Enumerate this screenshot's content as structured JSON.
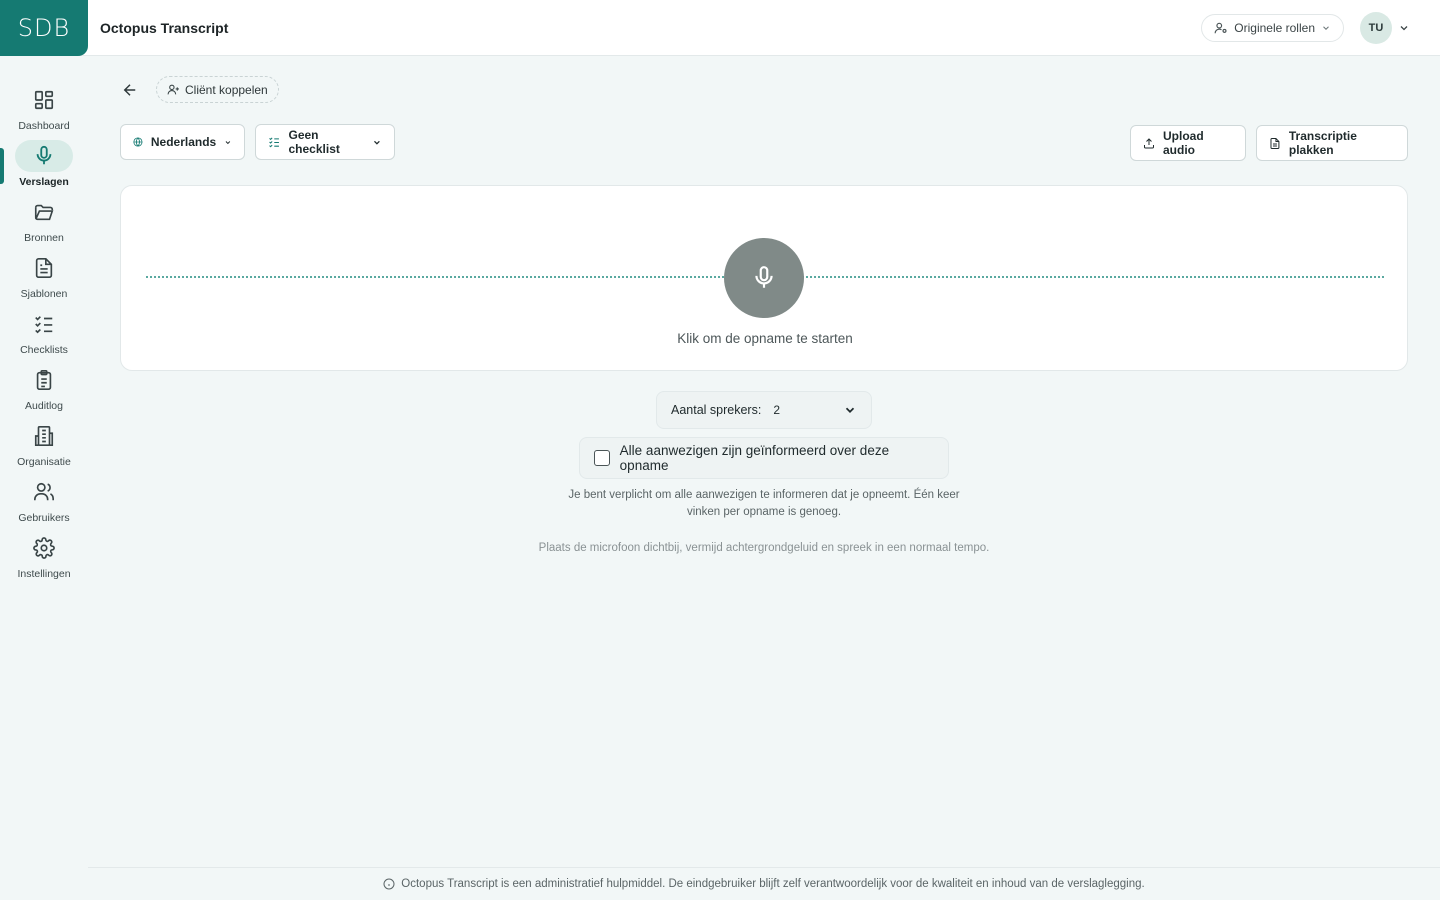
{
  "header": {
    "logo": "SDB",
    "app_title": "Octopus Transcript",
    "role_switch": "Originele rollen",
    "user_initials": "TU"
  },
  "sidebar": {
    "items": [
      {
        "label": "Dashboard",
        "icon": "dashboard-icon"
      },
      {
        "label": "Verslagen",
        "icon": "microphone-icon",
        "active": true
      },
      {
        "label": "Bronnen",
        "icon": "folder-icon"
      },
      {
        "label": "Sjablonen",
        "icon": "document-icon"
      },
      {
        "label": "Checklists",
        "icon": "checklist-icon"
      },
      {
        "label": "Auditlog",
        "icon": "clipboard-icon"
      },
      {
        "label": "Organisatie",
        "icon": "building-icon"
      },
      {
        "label": "Gebruikers",
        "icon": "users-icon"
      },
      {
        "label": "Instellingen",
        "icon": "gear-icon"
      }
    ]
  },
  "toolbar": {
    "client_link": "Cliënt koppelen",
    "language": "Nederlands",
    "checklist": "Geen checklist",
    "upload_audio": "Upload audio",
    "paste_transcript": "Transcriptie plakken"
  },
  "recorder": {
    "start_text": "Klik om de opname te starten"
  },
  "speakers": {
    "label": "Aantal sprekers:",
    "value": "2"
  },
  "consent": {
    "label": "Alle aanwezigen zijn geïnformeerd over deze opname",
    "checked": false,
    "note_line1": "Je bent verplicht om alle aanwezigen te informeren dat je opneemt. Één keer",
    "note_line2": "vinken per opname is genoeg."
  },
  "tip": "Plaats de microfoon dichtbij, vermijd achtergrondgeluid en spreek in een normaal tempo.",
  "footer": "Octopus Transcript is een administratief hulpmiddel. De eindgebruiker blijft zelf verantwoordelijk voor de kwaliteit en inhoud van de verslaglegging.",
  "colors": {
    "brand": "#157a72",
    "background": "#f2f7f7",
    "active_nav": "#d8ebe7",
    "mic_button": "#808a88"
  }
}
